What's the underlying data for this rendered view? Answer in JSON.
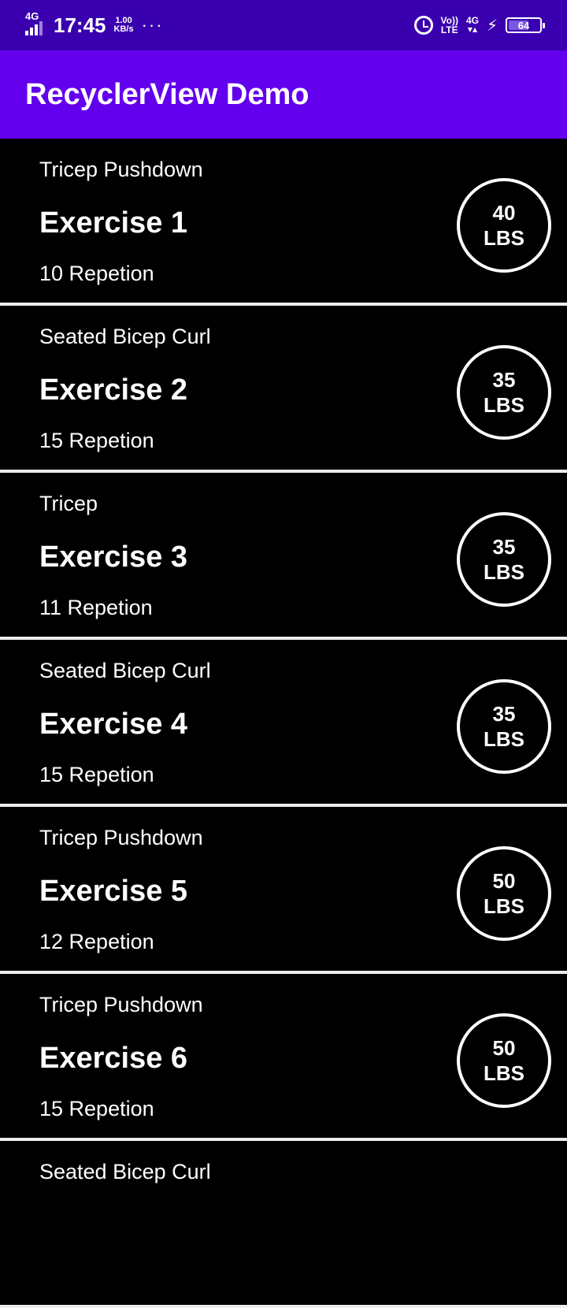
{
  "status_bar": {
    "network_tag": "4G",
    "time": "17:45",
    "speed_value": "1.00",
    "speed_unit": "KB/s",
    "more": "···",
    "volte_top": "Vo))",
    "volte_bottom": "LTE",
    "net_tag": "4G",
    "battery": "64",
    "icons": [
      "signal-icon",
      "alarm-icon",
      "volte-icon",
      "network-4g-icon",
      "charging-icon",
      "battery-icon"
    ]
  },
  "app_bar": {
    "title": "RecyclerView Demo",
    "color": "#6200ee"
  },
  "exercises": [
    {
      "subtitle": "Tricep Pushdown",
      "title": "Exercise 1",
      "reps": "10 Repetion",
      "weight": "40",
      "unit": "LBS"
    },
    {
      "subtitle": "Seated Bicep Curl",
      "title": "Exercise 2",
      "reps": "15 Repetion",
      "weight": "35",
      "unit": "LBS"
    },
    {
      "subtitle": "Tricep",
      "title": "Exercise 3",
      "reps": "11 Repetion",
      "weight": "35",
      "unit": "LBS"
    },
    {
      "subtitle": "Seated Bicep Curl",
      "title": "Exercise 4",
      "reps": "15 Repetion",
      "weight": "35",
      "unit": "LBS"
    },
    {
      "subtitle": "Tricep Pushdown",
      "title": "Exercise 5",
      "reps": "12 Repetion",
      "weight": "50",
      "unit": "LBS"
    },
    {
      "subtitle": "Tricep Pushdown",
      "title": "Exercise 6",
      "reps": "15 Repetion",
      "weight": "50",
      "unit": "LBS"
    },
    {
      "subtitle": "Seated Bicep Curl",
      "title": "",
      "reps": "",
      "weight": "",
      "unit": ""
    }
  ]
}
